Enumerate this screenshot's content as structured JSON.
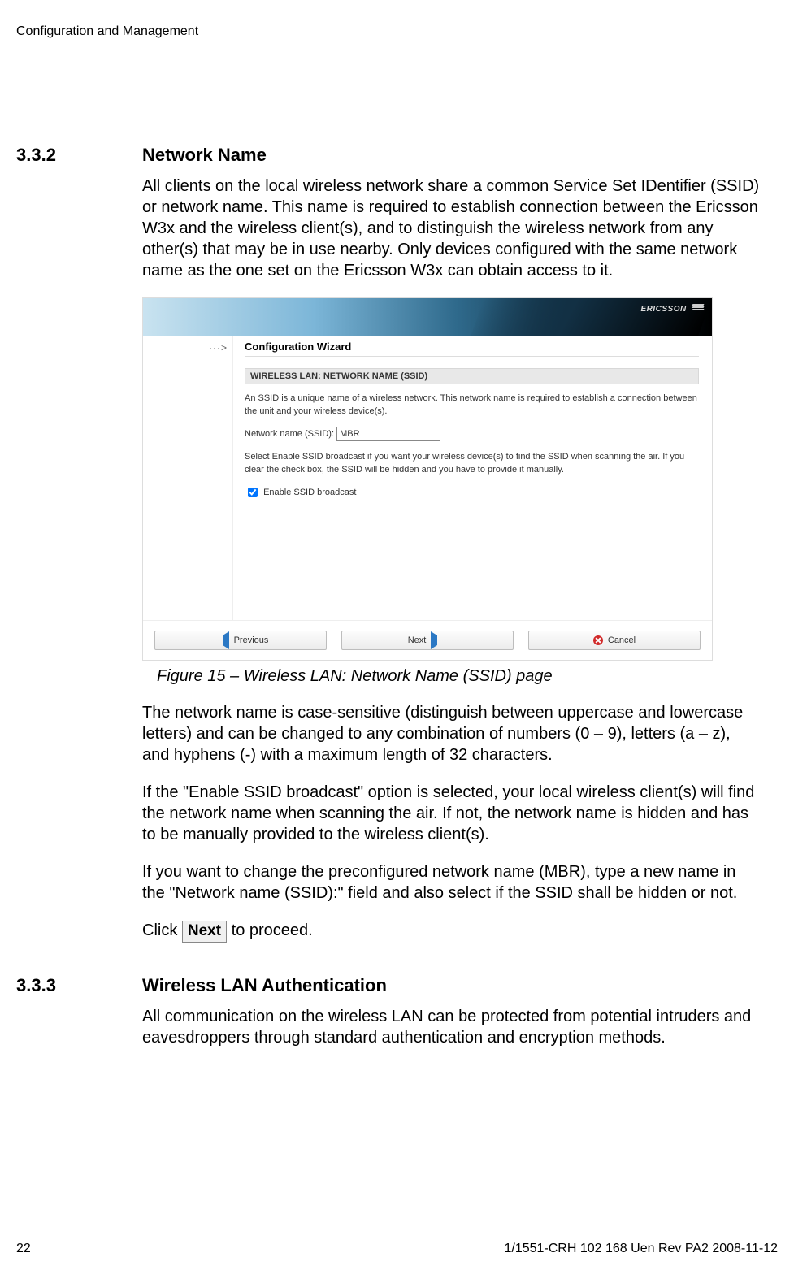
{
  "header": "Configuration and Management",
  "section332": {
    "num": "3.3.2",
    "title": "Network Name",
    "intro": "All clients on the local wireless network share a common Service Set IDentifier (SSID) or network name. This name is required to establish connection between the Ericsson W3x and the wireless client(s), and to distinguish the wireless network from any other(s) that may be in use nearby. Only devices configured with the same network name as the one set on the Ericsson W3x can obtain access to it.",
    "figcaption": "Figure 15 – Wireless LAN: Network Name (SSID) page",
    "para1": "The network name is case-sensitive (distinguish between uppercase and lowercase letters) and can be changed to any combination of numbers (0 – 9), letters (a – z), and hyphens (-) with a maximum length of 32 characters.",
    "para2": "If the \"Enable SSID broadcast\" option is selected, your local wireless client(s) will find the network name when scanning the air. If not, the network name is hidden and has to be manually provided to the wireless client(s).",
    "para3": "If you want to change the preconfigured network name (MBR), type a new name in the \"Network name (SSID):\" field and also select if the SSID shall be hidden or not.",
    "click_label_before": "Click ",
    "next_btn": " Next ",
    "click_label_after": " to proceed."
  },
  "wizard": {
    "brand": "ERICSSON",
    "arrow": "···>",
    "title": "Configuration Wizard",
    "section_heading": "WIRELESS LAN: NETWORK NAME (SSID)",
    "desc1": "An SSID is a unique name of a wireless network. This network name is required to establish a connection between the unit and your wireless device(s).",
    "field_label": "Network name (SSID):",
    "field_value": "MBR",
    "desc2": "Select Enable SSID broadcast if you want your wireless device(s) to find the SSID when scanning the air. If you clear the check box, the SSID will be hidden and you have to provide it manually.",
    "checkbox_label": " Enable SSID broadcast",
    "btn_prev": "Previous",
    "btn_next": "Next",
    "btn_cancel": "Cancel"
  },
  "section333": {
    "num": "3.3.3",
    "title": "Wireless LAN Authentication",
    "para": "All communication on the wireless LAN can be protected from potential intruders and eavesdroppers through standard authentication and encryption methods."
  },
  "footer": {
    "page": "22",
    "docid": "1/1551-CRH 102 168 Uen Rev PA2  2008-11-12"
  }
}
